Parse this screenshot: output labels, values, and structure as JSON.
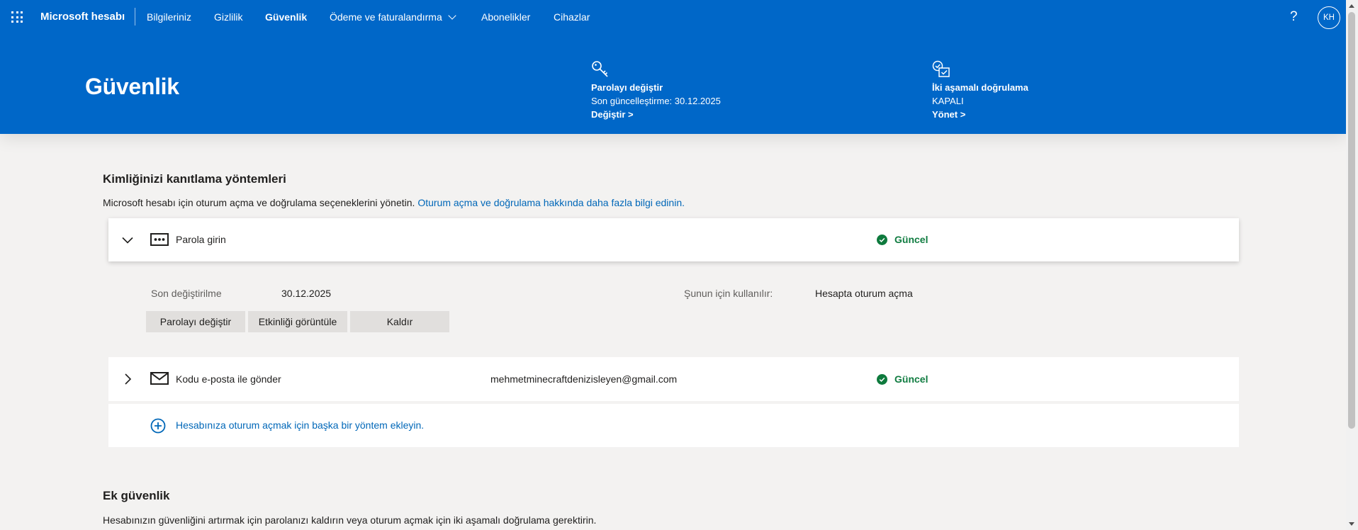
{
  "topnav": {
    "brand": "Microsoft hesabı",
    "items": [
      "Bilgileriniz",
      "Gizlilik",
      "Güvenlik",
      "Ödeme ve faturalandırma",
      "Abonelikler",
      "Cihazlar"
    ],
    "help": "?",
    "avatar_initials": "KH"
  },
  "hero": {
    "title": "Güvenlik",
    "password_card": {
      "title": "Parolayı değiştir",
      "subtitle": "Son güncelleştirme: 30.12.2025",
      "link": "Değiştir >"
    },
    "twofa_card": {
      "title": "İki aşamalı doğrulama",
      "subtitle": "KAPALI",
      "link": "Yönet >"
    }
  },
  "identity": {
    "title": "Kimliğinizi kanıtlama yöntemleri",
    "description": "Microsoft hesabı için oturum açma ve doğrulama seçeneklerini yönetin.",
    "learn_more": "Oturum açma ve doğrulama hakkında daha fazla bilgi edinin.",
    "methods": [
      {
        "name": "Parola girin",
        "status": "Güncel",
        "icon": "password-dots-icon",
        "expanded": true,
        "detail": ""
      },
      {
        "name": "Kodu e-posta ile gönder",
        "status": "Güncel",
        "icon": "mail-icon",
        "expanded": false,
        "detail": "mehmetminecraftdenizisleyen@gmail.com"
      }
    ],
    "password_details": {
      "last_changed_label": "Son değiştirilme",
      "last_changed_value": "30.12.2025",
      "used_for_label": "Şunun için kullanılır:",
      "used_for_value": "Hesapta oturum açma",
      "buttons": [
        "Parolayı değiştir",
        "Etkinliği görüntüle",
        "Kaldır"
      ]
    },
    "add_method": "Hesabınıza oturum açmak için başka bir yöntem ekleyin."
  },
  "extra_security": {
    "title": "Ek güvenlik",
    "description": "Hesabınızın güvenliğini artırmak için parolanızı kaldırın veya oturum açmak için iki aşamalı doğrulama gerektirin."
  },
  "colors": {
    "header_blue": "#0067c8",
    "link_blue": "#0067b8",
    "status_green": "#107c41",
    "page_bg": "#f3f2f1"
  }
}
